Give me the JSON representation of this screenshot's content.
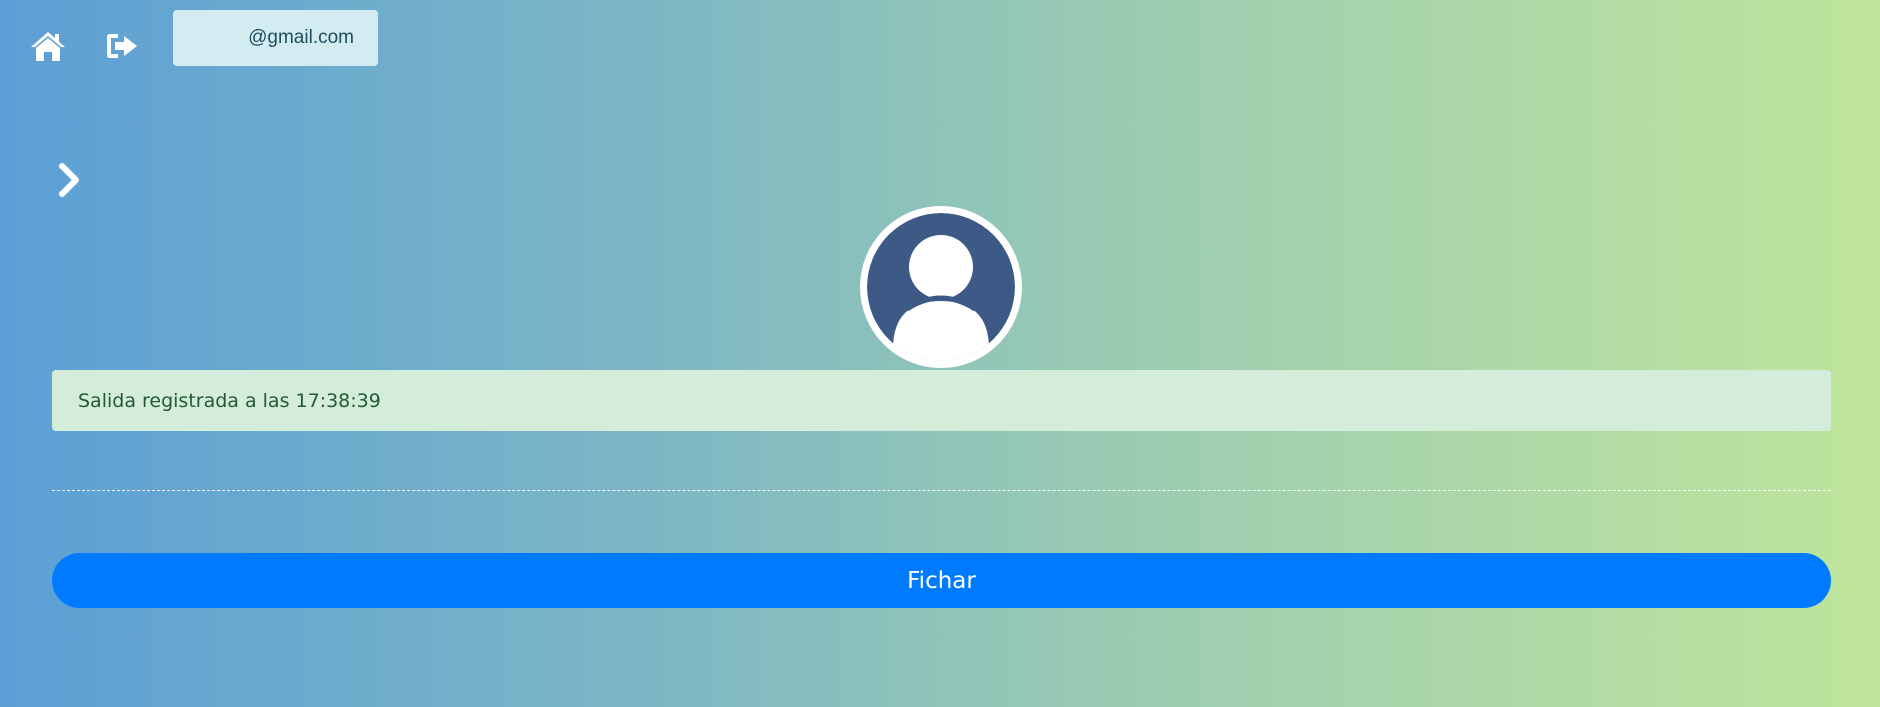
{
  "header": {
    "home_icon": "home-icon",
    "logout_icon": "sign-out-icon",
    "user_email": "@gmail.com"
  },
  "sidebar": {
    "toggle_icon": "chevron-right-icon"
  },
  "profile": {
    "avatar_icon": "user-avatar-icon",
    "avatar_color": "#3d5a86"
  },
  "alert": {
    "message": "Salida registrada a las 17:38:39",
    "background": "#d4ecda",
    "text_color": "#245a33"
  },
  "actions": {
    "clock_button_label": "Fichar",
    "clock_button_color": "#007bff"
  }
}
